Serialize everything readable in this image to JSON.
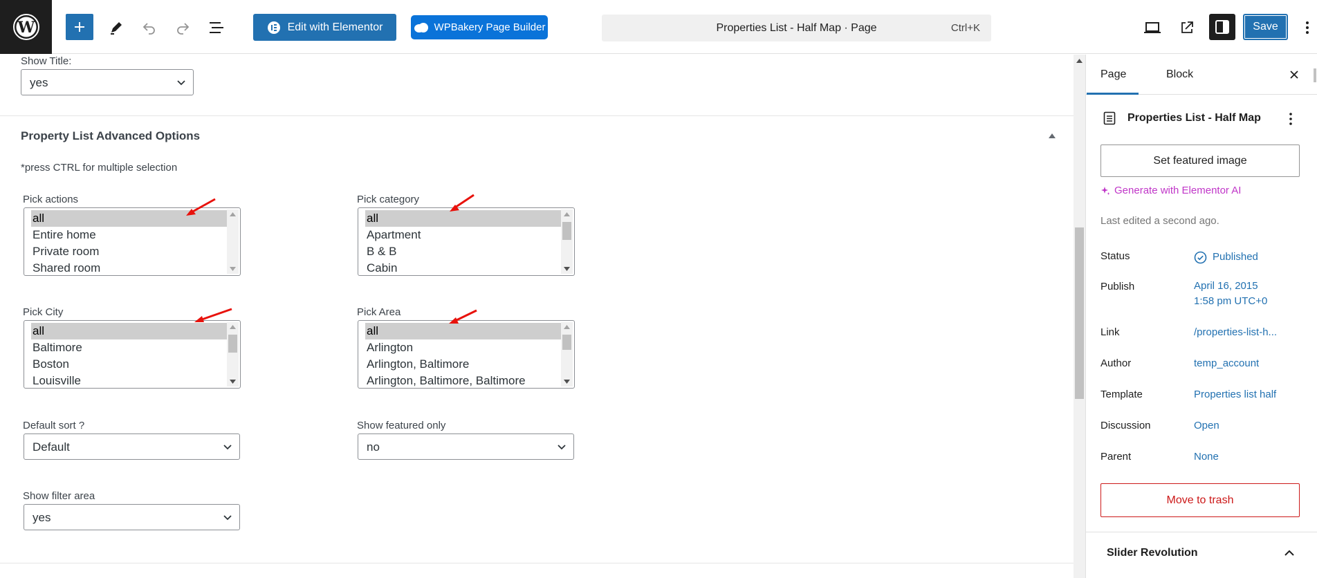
{
  "topbar": {
    "elementor_label": "Edit with Elementor",
    "wpbakery_label": "WPBakery Page Builder",
    "command_title": "Properties List - Half Map · Page",
    "command_shortcut": "Ctrl+K",
    "save_label": "Save"
  },
  "main": {
    "show_title": {
      "label": "Show Title:",
      "value": "yes"
    },
    "section_title": "Property List Advanced Options",
    "hint": "*press CTRL for multiple selection",
    "pick_actions": {
      "label": "Pick actions",
      "options": [
        "all",
        "Entire home",
        "Private room",
        "Shared room"
      ],
      "selected": "all"
    },
    "pick_category": {
      "label": "Pick category",
      "options": [
        "all",
        "Apartment",
        "B & B",
        "Cabin"
      ],
      "selected": "all"
    },
    "pick_city": {
      "label": "Pick City",
      "options": [
        "all",
        "Baltimore",
        "Boston",
        "Louisville"
      ],
      "selected": "all"
    },
    "pick_area": {
      "label": "Pick Area",
      "options": [
        "all",
        "Arlington",
        "Arlington, Baltimore",
        "Arlington, Baltimore, Baltimore"
      ],
      "selected": "all"
    },
    "default_sort": {
      "label": "Default sort ?",
      "value": "Default"
    },
    "show_featured": {
      "label": "Show featured only",
      "value": "no"
    },
    "show_filter": {
      "label": "Show filter area",
      "value": "yes"
    },
    "annotation_color": "#e8120c"
  },
  "sidebar": {
    "tabs": [
      "Page",
      "Block"
    ],
    "active_tab": "Page",
    "doc_title": "Properties List - Half Map",
    "featured_image_label": "Set featured image",
    "ai_label": "Generate with Elementor AI",
    "last_edited": "Last edited a second ago.",
    "rows": {
      "status": {
        "label": "Status",
        "value": "Published"
      },
      "publish": {
        "label": "Publish",
        "value_line1": "April 16, 2015",
        "value_line2": "1:58 pm UTC+0"
      },
      "link": {
        "label": "Link",
        "value": "/properties-list-h..."
      },
      "author": {
        "label": "Author",
        "value": "temp_account"
      },
      "template": {
        "label": "Template",
        "value": "Properties list half"
      },
      "discussion": {
        "label": "Discussion",
        "value": "Open"
      },
      "parent": {
        "label": "Parent",
        "value": "None"
      }
    },
    "trash_label": "Move to trash",
    "slider_title": "Slider Revolution"
  },
  "colors": {
    "accent": "#2271b1",
    "trash": "#cc1818",
    "ai": "#c036c8",
    "wpbakery": "#0a73d9"
  }
}
